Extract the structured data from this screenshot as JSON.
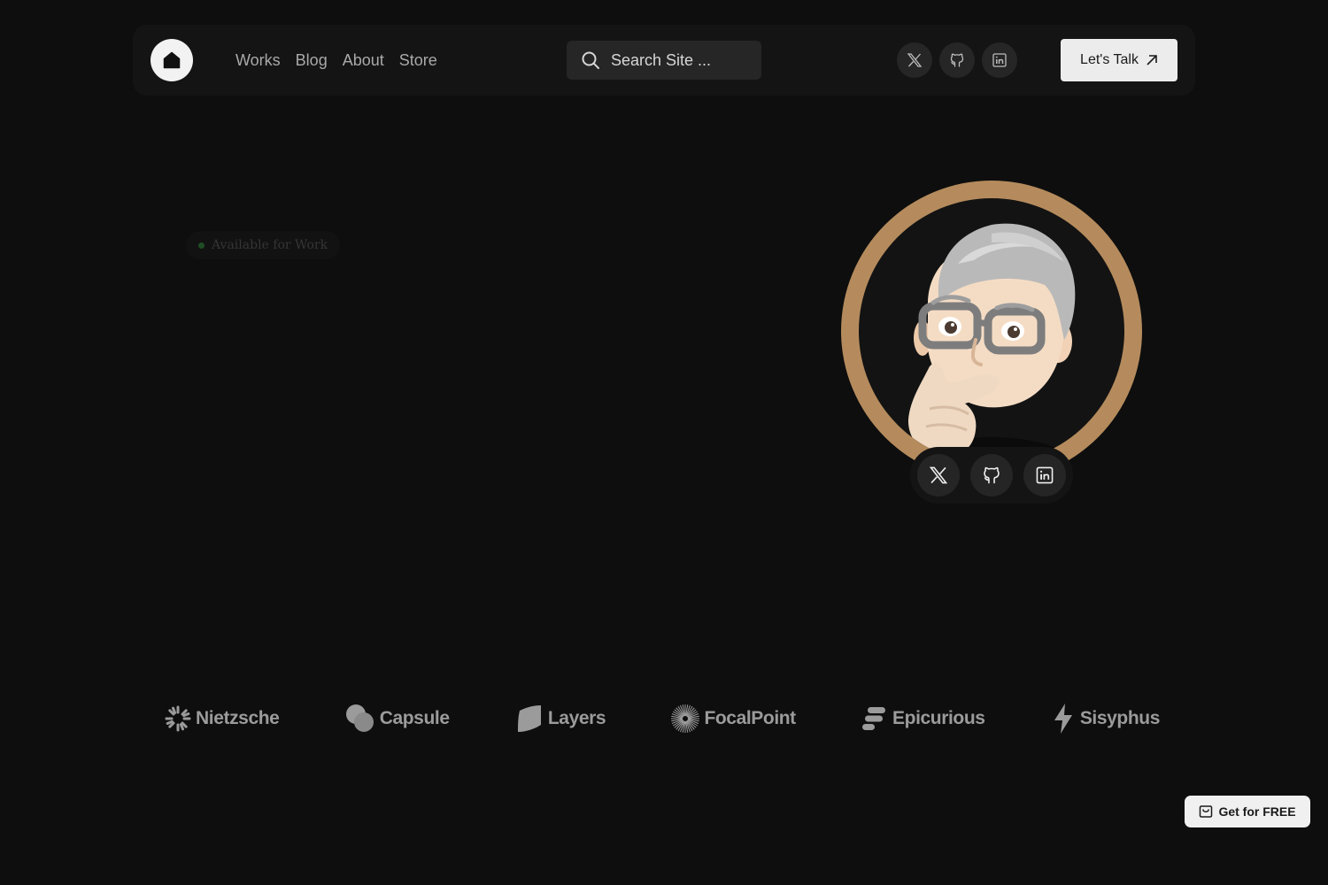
{
  "nav": {
    "links": [
      "Works",
      "Blog",
      "About",
      "Store"
    ],
    "search_placeholder": "Search Site ...",
    "cta_label": "Let's Talk"
  },
  "hero": {
    "availability": "Available for Work"
  },
  "logos": [
    "Nietzsche",
    "Capsule",
    "Layers",
    "FocalPoint",
    "Epicurious",
    "Sisyphus"
  ],
  "floating": {
    "get_free_label": "Get for FREE"
  },
  "colors": {
    "background": "#0e0e0e",
    "avatar_ring": "#b58b5d",
    "status_dot": "#1f4d24"
  },
  "icons": [
    "home-icon",
    "search-icon",
    "x-icon",
    "github-icon",
    "linkedin-icon",
    "arrow-up-right-icon",
    "bag-icon"
  ]
}
